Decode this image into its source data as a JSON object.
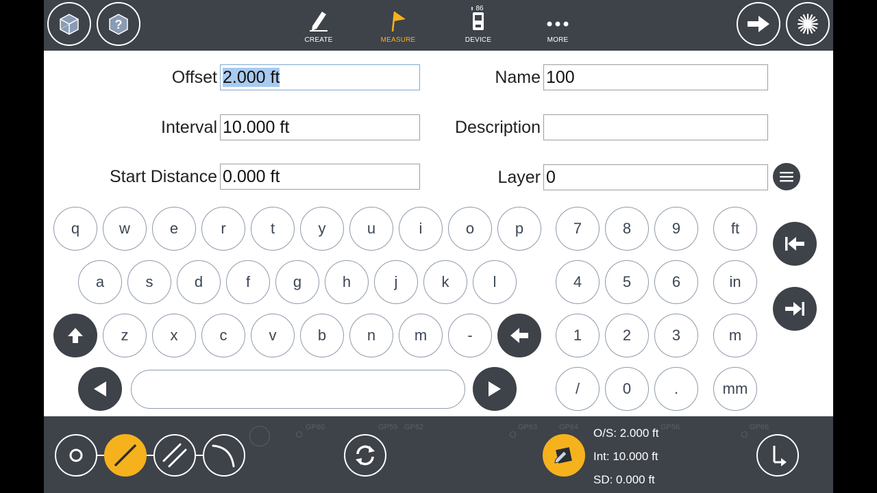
{
  "topbar": {
    "nav": [
      {
        "label": "CREATE",
        "icon": "pencil-icon"
      },
      {
        "label": "MEASURE",
        "icon": "flag-icon",
        "active": true
      },
      {
        "label": "DEVICE",
        "icon": "total-station-icon",
        "badge": "86"
      },
      {
        "label": "MORE",
        "icon": "more-dots-icon"
      }
    ],
    "left_buttons": [
      "cube-icon",
      "help-icon"
    ],
    "right_buttons": [
      "arrow-right-icon",
      "starburst-icon"
    ]
  },
  "form": {
    "offset": {
      "label": "Offset",
      "value": "2.000 ft"
    },
    "interval": {
      "label": "Interval",
      "value": "10.000 ft"
    },
    "start_distance": {
      "label": "Start Distance",
      "value": "0.000 ft"
    },
    "name": {
      "label": "Name",
      "value": "100"
    },
    "description": {
      "label": "Description",
      "value": ""
    },
    "layer": {
      "label": "Layer",
      "value": "0"
    }
  },
  "keyboard": {
    "row1": [
      "q",
      "w",
      "e",
      "r",
      "t",
      "y",
      "u",
      "i",
      "o",
      "p"
    ],
    "row2": [
      "a",
      "s",
      "d",
      "f",
      "g",
      "h",
      "j",
      "k",
      "l"
    ],
    "row3": [
      "z",
      "x",
      "c",
      "v",
      "b",
      "n",
      "m",
      "-"
    ],
    "numpad": [
      [
        "7",
        "8",
        "9",
        "ft"
      ],
      [
        "4",
        "5",
        "6",
        "in"
      ],
      [
        "1",
        "2",
        "3",
        "m"
      ],
      [
        "/",
        "0",
        ".",
        "mm"
      ]
    ]
  },
  "background_labels": [
    "GP60",
    "GP59",
    "GP62",
    "GP63",
    "GP64",
    "GP56",
    "GP66"
  ],
  "status": {
    "offset": "O/S:  2.000 ft",
    "interval": "Int:  10.000 ft",
    "start_distance": "SD:  0.000 ft"
  },
  "colors": {
    "bar": "#3e4249",
    "accent": "#f6b21c",
    "selection": "#a8cbee",
    "key_border": "#8e9aab"
  }
}
